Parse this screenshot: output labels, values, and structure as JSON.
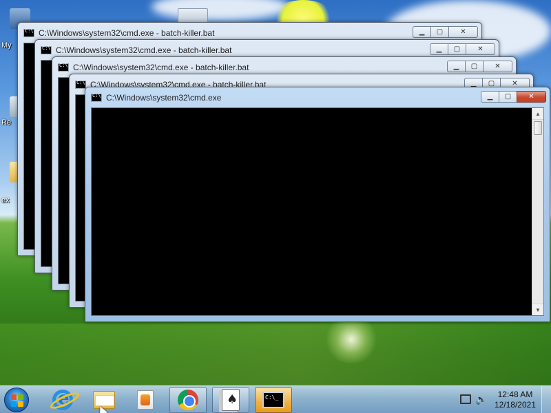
{
  "desktop": {
    "icons": [
      {
        "label": "My"
      },
      {
        "label": "Re"
      },
      {
        "label": "ex"
      }
    ]
  },
  "windows": [
    {
      "title": "C:\\Windows\\system32\\cmd.exe - batch-killer.bat"
    },
    {
      "title": "C:\\Windows\\system32\\cmd.exe - batch-killer.bat"
    },
    {
      "title": "C:\\Windows\\system32\\cmd.exe - batch-killer.bat"
    },
    {
      "title": "C:\\Windows\\system32\\cmd.exe - batch-killer.bat"
    },
    {
      "title": "C:\\Windows\\system32\\cmd.exe",
      "active": true
    }
  ],
  "window_controls": {
    "minimize": "▁",
    "maximize": "▢",
    "close": "✕"
  },
  "taskbar": {
    "items": [
      {
        "icon": "internet-explorer-icon"
      },
      {
        "icon": "file-explorer-icon"
      },
      {
        "icon": "media-player-icon"
      },
      {
        "icon": "chrome-icon"
      },
      {
        "icon": "solitaire-icon"
      },
      {
        "icon": "command-prompt-icon",
        "active": true
      }
    ],
    "clock": {
      "time": "12:48 AM",
      "date": "12/18/2021"
    }
  },
  "colors": {
    "console_bg": "#000000",
    "close_red": "#c84a2e",
    "active_task": "#f0b040"
  }
}
